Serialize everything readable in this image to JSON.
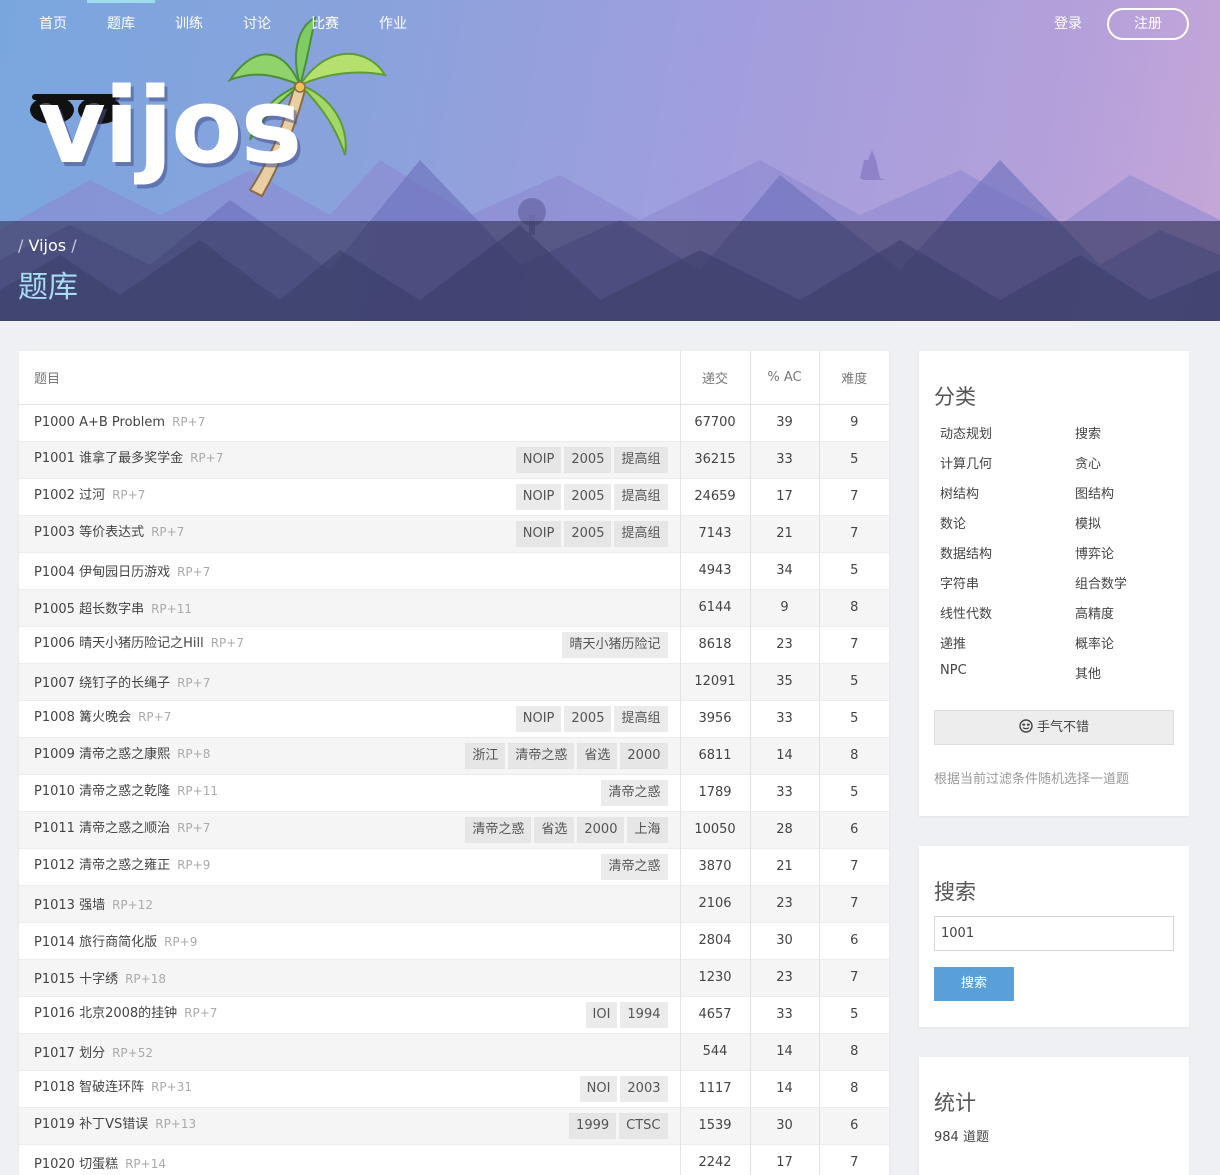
{
  "nav": {
    "items": [
      "首页",
      "题库",
      "训练",
      "讨论",
      "比赛",
      "作业"
    ],
    "active_index": 1,
    "login": "登录",
    "register": "注册"
  },
  "logo": {
    "text": "vijos"
  },
  "breadcrumb": {
    "sep": "/",
    "root": "Vijos"
  },
  "page_title": "题库",
  "table": {
    "headers": {
      "title": "题目",
      "submit": "递交",
      "ac": "% AC",
      "difficulty": "难度"
    },
    "rows": [
      {
        "pid": "P1000",
        "name": "A+B Problem",
        "rp": "RP+7",
        "tags": [],
        "submit": "67700",
        "ac": "39",
        "diff": "9"
      },
      {
        "pid": "P1001",
        "name": "谁拿了最多奖学金",
        "rp": "RP+7",
        "tags": [
          "NOIP",
          "2005",
          "提高组"
        ],
        "submit": "36215",
        "ac": "33",
        "diff": "5"
      },
      {
        "pid": "P1002",
        "name": "过河",
        "rp": "RP+7",
        "tags": [
          "NOIP",
          "2005",
          "提高组"
        ],
        "submit": "24659",
        "ac": "17",
        "diff": "7"
      },
      {
        "pid": "P1003",
        "name": "等价表达式",
        "rp": "RP+7",
        "tags": [
          "NOIP",
          "2005",
          "提高组"
        ],
        "submit": "7143",
        "ac": "21",
        "diff": "7"
      },
      {
        "pid": "P1004",
        "name": "伊甸园日历游戏",
        "rp": "RP+7",
        "tags": [],
        "submit": "4943",
        "ac": "34",
        "diff": "5"
      },
      {
        "pid": "P1005",
        "name": "超长数字串",
        "rp": "RP+11",
        "tags": [],
        "submit": "6144",
        "ac": "9",
        "diff": "8"
      },
      {
        "pid": "P1006",
        "name": "晴天小猪历险记之Hill",
        "rp": "RP+7",
        "tags": [
          "晴天小猪历险记"
        ],
        "submit": "8618",
        "ac": "23",
        "diff": "7"
      },
      {
        "pid": "P1007",
        "name": "绕钉子的长绳子",
        "rp": "RP+7",
        "tags": [],
        "submit": "12091",
        "ac": "35",
        "diff": "5"
      },
      {
        "pid": "P1008",
        "name": "篝火晚会",
        "rp": "RP+7",
        "tags": [
          "NOIP",
          "2005",
          "提高组"
        ],
        "submit": "3956",
        "ac": "33",
        "diff": "5"
      },
      {
        "pid": "P1009",
        "name": "清帝之惑之康熙",
        "rp": "RP+8",
        "tags": [
          "浙江",
          "清帝之惑",
          "省选",
          "2000"
        ],
        "submit": "6811",
        "ac": "14",
        "diff": "8"
      },
      {
        "pid": "P1010",
        "name": "清帝之惑之乾隆",
        "rp": "RP+11",
        "tags": [
          "清帝之惑"
        ],
        "submit": "1789",
        "ac": "33",
        "diff": "5"
      },
      {
        "pid": "P1011",
        "name": "清帝之惑之顺治",
        "rp": "RP+7",
        "tags": [
          "清帝之惑",
          "省选",
          "2000",
          "上海"
        ],
        "submit": "10050",
        "ac": "28",
        "diff": "6"
      },
      {
        "pid": "P1012",
        "name": "清帝之惑之雍正",
        "rp": "RP+9",
        "tags": [
          "清帝之惑"
        ],
        "submit": "3870",
        "ac": "21",
        "diff": "7"
      },
      {
        "pid": "P1013",
        "name": "强墙",
        "rp": "RP+12",
        "tags": [],
        "submit": "2106",
        "ac": "23",
        "diff": "7"
      },
      {
        "pid": "P1014",
        "name": "旅行商简化版",
        "rp": "RP+9",
        "tags": [],
        "submit": "2804",
        "ac": "30",
        "diff": "6"
      },
      {
        "pid": "P1015",
        "name": "十字绣",
        "rp": "RP+18",
        "tags": [],
        "submit": "1230",
        "ac": "23",
        "diff": "7"
      },
      {
        "pid": "P1016",
        "name": "北京2008的挂钟",
        "rp": "RP+7",
        "tags": [
          "IOI",
          "1994"
        ],
        "submit": "4657",
        "ac": "33",
        "diff": "5"
      },
      {
        "pid": "P1017",
        "name": "划分",
        "rp": "RP+52",
        "tags": [],
        "submit": "544",
        "ac": "14",
        "diff": "8"
      },
      {
        "pid": "P1018",
        "name": "智破连环阵",
        "rp": "RP+31",
        "tags": [
          "NOI",
          "2003"
        ],
        "submit": "1117",
        "ac": "14",
        "diff": "8"
      },
      {
        "pid": "P1019",
        "name": "补丁VS错误",
        "rp": "RP+13",
        "tags": [
          "1999",
          "CTSC"
        ],
        "submit": "1539",
        "ac": "30",
        "diff": "6"
      },
      {
        "pid": "P1020",
        "name": "切蛋糕",
        "rp": "RP+14",
        "tags": [],
        "submit": "2242",
        "ac": "17",
        "diff": "7"
      }
    ]
  },
  "sidebar": {
    "categories": {
      "title": "分类",
      "items": [
        "动态规划",
        "搜索",
        "计算几何",
        "贪心",
        "树结构",
        "图结构",
        "数论",
        "模拟",
        "数据结构",
        "博弈论",
        "字符串",
        "组合数学",
        "线性代数",
        "高精度",
        "递推",
        "概率论",
        "NPC",
        "其他"
      ],
      "lucky_icon": "smile-icon",
      "lucky_label": "手气不错",
      "lucky_note": "根据当前过滤条件随机选择一道题"
    },
    "search": {
      "title": "搜索",
      "value": "1001",
      "button": "搜索"
    },
    "stats": {
      "title": "统计",
      "text": "984 道题"
    }
  }
}
